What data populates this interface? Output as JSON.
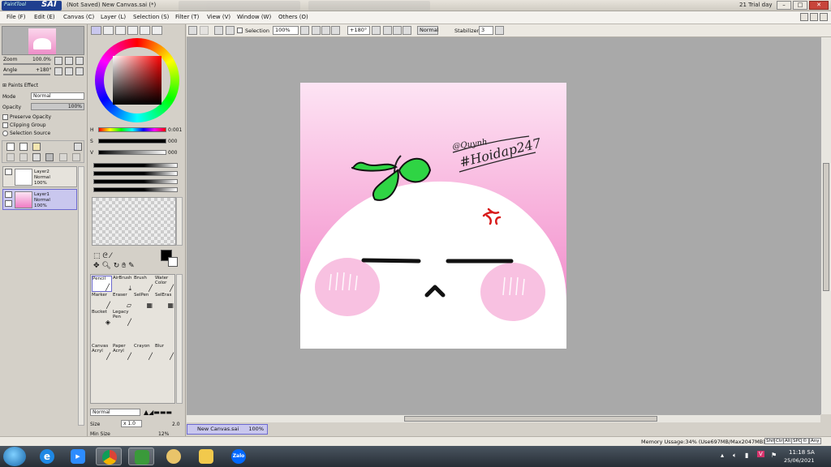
{
  "titlebar": {
    "logo_small": "PaintTool",
    "logo_big": "SAI",
    "title": "(Not Saved) New Canvas.sai (*)",
    "trial": "21 Trial day"
  },
  "menu": [
    "File (F)",
    "Edit (E)",
    "Canvas (C)",
    "Layer (L)",
    "Selection (S)",
    "Filter (T)",
    "View (V)",
    "Window (W)",
    "Others (O)"
  ],
  "navigator": {
    "zoom_label": "Zoom",
    "zoom_value": "100.0%",
    "angle_label": "Angle",
    "angle_value": "+180°"
  },
  "layer_props": {
    "paints_effect": "Paints Effect",
    "mode_label": "Mode",
    "mode_value": "Normal",
    "opacity_label": "Opacity",
    "opacity_value": "100%",
    "preserve_opacity": "Preserve Opacity",
    "clipping_group": "Clipping Group",
    "selection_source": "Selection Source"
  },
  "layers": [
    {
      "name": "Layer2",
      "mode": "Normal",
      "opacity": "100%"
    },
    {
      "name": "Layer1",
      "mode": "Normal",
      "opacity": "100%"
    }
  ],
  "color": {
    "h_label": "H",
    "h_value": "0:001",
    "s_label": "S",
    "s_value": "000",
    "v_label": "V",
    "v_value": "000",
    "current_color": "#000000"
  },
  "tools": [
    {
      "name": "Pencil",
      "selected": true
    },
    {
      "name": "AirBrush",
      "selected": false
    },
    {
      "name": "Brush",
      "selected": false
    },
    {
      "name": "Water Color",
      "selected": false
    },
    {
      "name": "Marker",
      "selected": false
    },
    {
      "name": "Eraser",
      "selected": false
    },
    {
      "name": "SelPen",
      "selected": false
    },
    {
      "name": "SelEras",
      "selected": false
    },
    {
      "name": "Bucket",
      "selected": false
    },
    {
      "name": "Legacy Pen",
      "selected": false
    },
    {
      "name": "Canvas Acryl",
      "selected": false
    },
    {
      "name": "Paper Acryl",
      "selected": false
    },
    {
      "name": "Crayon",
      "selected": false
    },
    {
      "name": "Blur",
      "selected": false
    }
  ],
  "brush": {
    "blend_mode": "Normal",
    "size_label": "Size",
    "size_multiplier": "x 1.0",
    "size_value": "2.0",
    "min_size_label": "Min Size",
    "min_size_value": "12%"
  },
  "canvas_toolbar": {
    "selection_label": "Selection",
    "zoom": "100%",
    "angle": "+180°",
    "mode": "Normal",
    "stabilizer_label": "Stabilizer",
    "stabilizer_value": "3"
  },
  "artwork": {
    "signature_top": "@Quynh",
    "signature_tag": "#Hoidap247"
  },
  "doc_tabs": [
    {
      "name": "New Canvas.sai",
      "zoom": "100%"
    }
  ],
  "status": {
    "memory": "Memory Ussage:34% (Use697MB/Max2047MB)",
    "keys": [
      "Shift",
      "Ctrl",
      "Alt",
      "SPC",
      "©",
      "Any"
    ]
  },
  "taskbar": {
    "apps": [
      "Internet Explorer",
      "Zoom",
      "Chrome",
      "PaintTool SAI",
      "Paint",
      "Explorer",
      "Zalo"
    ],
    "zalo_label": "Zalo",
    "time": "11:18 SA",
    "date": "25/06/2021"
  }
}
